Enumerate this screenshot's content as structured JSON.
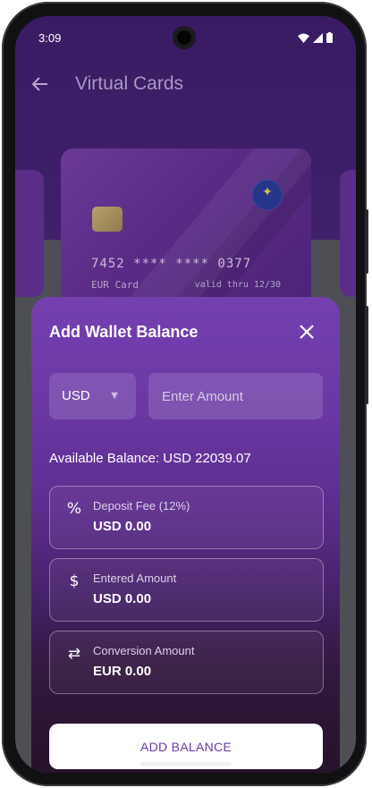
{
  "status_bar": {
    "time": "3:09"
  },
  "app_bar": {
    "title": "Virtual Cards",
    "back_icon": "arrow-left-icon"
  },
  "card": {
    "number": "7452 **** **** 0377",
    "label": "EUR Card",
    "valid": "valid thru 12/30"
  },
  "sheet": {
    "title": "Add Wallet Balance",
    "currency": "USD",
    "amount_placeholder": "Enter Amount",
    "available_balance": "Available Balance: USD 22039.07",
    "fee": {
      "label": "Deposit Fee (12%)",
      "value": "USD 0.00",
      "icon": "percent-icon"
    },
    "entered": {
      "label": "Entered Amount",
      "value": "USD 0.00",
      "icon": "dollar-icon"
    },
    "conversion": {
      "label": "Conversion Amount",
      "value": "EUR 0.00",
      "icon": "swap-arrows-icon"
    },
    "button": "ADD BALANCE"
  },
  "colors": {
    "accent": "#6a3aa5",
    "header_bg": "#3a1b63"
  }
}
